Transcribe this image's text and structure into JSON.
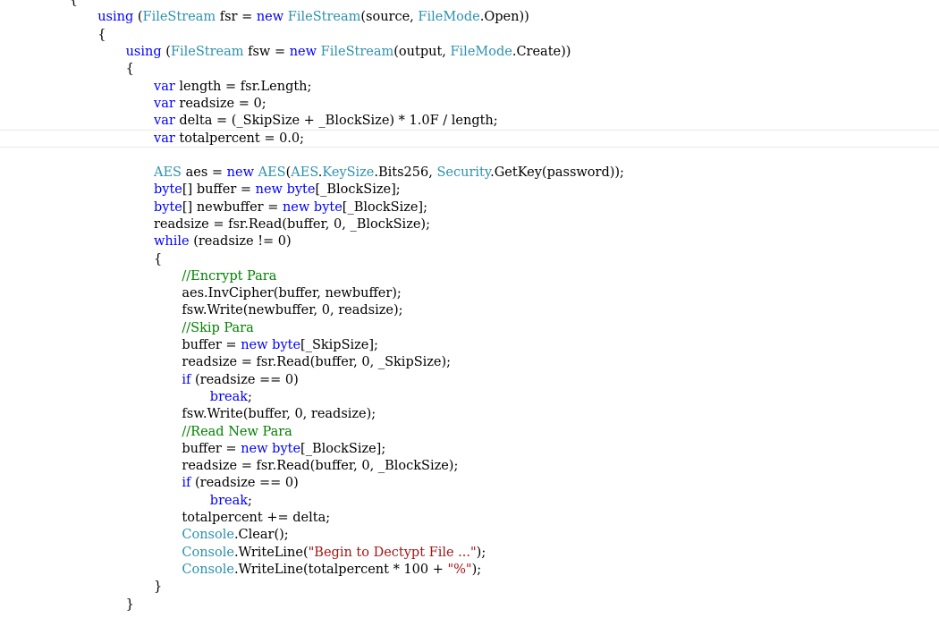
{
  "editor": {
    "colors": {
      "keyword": "#0000ff",
      "type": "#2b91af",
      "comment": "#008000",
      "string": "#a31515",
      "plain": "#000000",
      "current_line_border": "#e8e8e8"
    },
    "current_line": 8,
    "lines": [
      {
        "indent": 2,
        "tokens": [
          {
            "t": "{",
            "k": "plain"
          }
        ]
      },
      {
        "indent": 3,
        "tokens": [
          {
            "t": "using",
            "k": "keyword"
          },
          {
            "t": " (",
            "k": "plain"
          },
          {
            "t": "FileStream",
            "k": "type"
          },
          {
            "t": " fsr = ",
            "k": "plain"
          },
          {
            "t": "new",
            "k": "keyword"
          },
          {
            "t": " ",
            "k": "plain"
          },
          {
            "t": "FileStream",
            "k": "type"
          },
          {
            "t": "(source, ",
            "k": "plain"
          },
          {
            "t": "FileMode",
            "k": "type"
          },
          {
            "t": ".Open))",
            "k": "plain"
          }
        ]
      },
      {
        "indent": 3,
        "tokens": [
          {
            "t": "{",
            "k": "plain"
          }
        ]
      },
      {
        "indent": 4,
        "tokens": [
          {
            "t": "using",
            "k": "keyword"
          },
          {
            "t": " (",
            "k": "plain"
          },
          {
            "t": "FileStream",
            "k": "type"
          },
          {
            "t": " fsw = ",
            "k": "plain"
          },
          {
            "t": "new",
            "k": "keyword"
          },
          {
            "t": " ",
            "k": "plain"
          },
          {
            "t": "FileStream",
            "k": "type"
          },
          {
            "t": "(output, ",
            "k": "plain"
          },
          {
            "t": "FileMode",
            "k": "type"
          },
          {
            "t": ".Create))",
            "k": "plain"
          }
        ]
      },
      {
        "indent": 4,
        "tokens": [
          {
            "t": "{",
            "k": "plain"
          }
        ]
      },
      {
        "indent": 5,
        "tokens": [
          {
            "t": "var",
            "k": "keyword"
          },
          {
            "t": " length = fsr.Length;",
            "k": "plain"
          }
        ]
      },
      {
        "indent": 5,
        "tokens": [
          {
            "t": "var",
            "k": "keyword"
          },
          {
            "t": " readsize = 0;",
            "k": "plain"
          }
        ]
      },
      {
        "indent": 5,
        "tokens": [
          {
            "t": "var",
            "k": "keyword"
          },
          {
            "t": " delta = (_SkipSize + _BlockSize) * 1.0F / length;",
            "k": "plain"
          }
        ]
      },
      {
        "indent": 5,
        "tokens": [
          {
            "t": "var",
            "k": "keyword"
          },
          {
            "t": " totalpercent = 0.0;",
            "k": "plain"
          }
        ]
      },
      {
        "indent": 0,
        "tokens": []
      },
      {
        "indent": 5,
        "tokens": [
          {
            "t": "AES",
            "k": "type"
          },
          {
            "t": " aes = ",
            "k": "plain"
          },
          {
            "t": "new",
            "k": "keyword"
          },
          {
            "t": " ",
            "k": "plain"
          },
          {
            "t": "AES",
            "k": "type"
          },
          {
            "t": "(",
            "k": "plain"
          },
          {
            "t": "AES",
            "k": "type"
          },
          {
            "t": ".",
            "k": "plain"
          },
          {
            "t": "KeySize",
            "k": "type"
          },
          {
            "t": ".Bits256, ",
            "k": "plain"
          },
          {
            "t": "Security",
            "k": "type"
          },
          {
            "t": ".GetKey(password));",
            "k": "plain"
          }
        ]
      },
      {
        "indent": 5,
        "tokens": [
          {
            "t": "byte",
            "k": "keyword"
          },
          {
            "t": "[] buffer = ",
            "k": "plain"
          },
          {
            "t": "new",
            "k": "keyword"
          },
          {
            "t": " ",
            "k": "plain"
          },
          {
            "t": "byte",
            "k": "keyword"
          },
          {
            "t": "[_BlockSize];",
            "k": "plain"
          }
        ]
      },
      {
        "indent": 5,
        "tokens": [
          {
            "t": "byte",
            "k": "keyword"
          },
          {
            "t": "[] newbuffer = ",
            "k": "plain"
          },
          {
            "t": "new",
            "k": "keyword"
          },
          {
            "t": " ",
            "k": "plain"
          },
          {
            "t": "byte",
            "k": "keyword"
          },
          {
            "t": "[_BlockSize];",
            "k": "plain"
          }
        ]
      },
      {
        "indent": 5,
        "tokens": [
          {
            "t": "readsize = fsr.Read(buffer, 0, _BlockSize);",
            "k": "plain"
          }
        ]
      },
      {
        "indent": 5,
        "tokens": [
          {
            "t": "while",
            "k": "keyword"
          },
          {
            "t": " (readsize != 0)",
            "k": "plain"
          }
        ]
      },
      {
        "indent": 5,
        "tokens": [
          {
            "t": "{",
            "k": "plain"
          }
        ]
      },
      {
        "indent": 6,
        "tokens": [
          {
            "t": "//Encrypt Para",
            "k": "comment"
          }
        ]
      },
      {
        "indent": 6,
        "tokens": [
          {
            "t": "aes.InvCipher(buffer, newbuffer);",
            "k": "plain"
          }
        ]
      },
      {
        "indent": 6,
        "tokens": [
          {
            "t": "fsw.Write(newbuffer, 0, readsize);",
            "k": "plain"
          }
        ]
      },
      {
        "indent": 6,
        "tokens": [
          {
            "t": "//Skip Para",
            "k": "comment"
          }
        ]
      },
      {
        "indent": 6,
        "tokens": [
          {
            "t": "buffer = ",
            "k": "plain"
          },
          {
            "t": "new",
            "k": "keyword"
          },
          {
            "t": " ",
            "k": "plain"
          },
          {
            "t": "byte",
            "k": "keyword"
          },
          {
            "t": "[_SkipSize];",
            "k": "plain"
          }
        ]
      },
      {
        "indent": 6,
        "tokens": [
          {
            "t": "readsize = fsr.Read(buffer, 0, _SkipSize);",
            "k": "plain"
          }
        ]
      },
      {
        "indent": 6,
        "tokens": [
          {
            "t": "if",
            "k": "keyword"
          },
          {
            "t": " (readsize == 0)",
            "k": "plain"
          }
        ]
      },
      {
        "indent": 7,
        "tokens": [
          {
            "t": "break",
            "k": "keyword"
          },
          {
            "t": ";",
            "k": "plain"
          }
        ]
      },
      {
        "indent": 6,
        "tokens": [
          {
            "t": "fsw.Write(buffer, 0, readsize);",
            "k": "plain"
          }
        ]
      },
      {
        "indent": 6,
        "tokens": [
          {
            "t": "//Read New Para",
            "k": "comment"
          }
        ]
      },
      {
        "indent": 6,
        "tokens": [
          {
            "t": "buffer = ",
            "k": "plain"
          },
          {
            "t": "new",
            "k": "keyword"
          },
          {
            "t": " ",
            "k": "plain"
          },
          {
            "t": "byte",
            "k": "keyword"
          },
          {
            "t": "[_BlockSize];",
            "k": "plain"
          }
        ]
      },
      {
        "indent": 6,
        "tokens": [
          {
            "t": "readsize = fsr.Read(buffer, 0, _BlockSize);",
            "k": "plain"
          }
        ]
      },
      {
        "indent": 6,
        "tokens": [
          {
            "t": "if",
            "k": "keyword"
          },
          {
            "t": " (readsize == 0)",
            "k": "plain"
          }
        ]
      },
      {
        "indent": 7,
        "tokens": [
          {
            "t": "break",
            "k": "keyword"
          },
          {
            "t": ";",
            "k": "plain"
          }
        ]
      },
      {
        "indent": 6,
        "tokens": [
          {
            "t": "totalpercent += delta;",
            "k": "plain"
          }
        ]
      },
      {
        "indent": 6,
        "tokens": [
          {
            "t": "Console",
            "k": "type"
          },
          {
            "t": ".Clear();",
            "k": "plain"
          }
        ]
      },
      {
        "indent": 6,
        "tokens": [
          {
            "t": "Console",
            "k": "type"
          },
          {
            "t": ".WriteLine(",
            "k": "plain"
          },
          {
            "t": "\"Begin to Dectypt File ...\"",
            "k": "string"
          },
          {
            "t": ");",
            "k": "plain"
          }
        ]
      },
      {
        "indent": 6,
        "tokens": [
          {
            "t": "Console",
            "k": "type"
          },
          {
            "t": ".WriteLine(totalpercent * 100 + ",
            "k": "plain"
          },
          {
            "t": "\"%\"",
            "k": "string"
          },
          {
            "t": ");",
            "k": "plain"
          }
        ]
      },
      {
        "indent": 5,
        "tokens": [
          {
            "t": "}",
            "k": "plain"
          }
        ]
      },
      {
        "indent": 4,
        "tokens": [
          {
            "t": "}",
            "k": "plain"
          }
        ]
      }
    ]
  }
}
